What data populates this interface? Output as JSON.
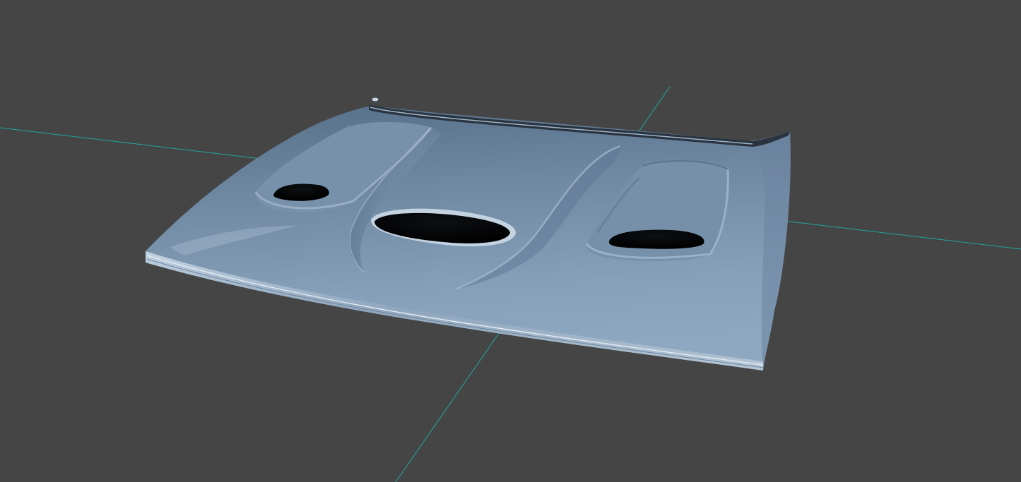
{
  "viewport": {
    "background_color": "#454545",
    "grid_axis_color": "#1fa7a0",
    "model": {
      "object": "car-hood",
      "base_color": "#7f97b0",
      "shadow_color": "#4f6680",
      "highlight_color": "#a9bed2",
      "vent_color": "#050608",
      "features": [
        "left-hood-vent-icon",
        "center-hood-scoop-icon",
        "right-hood-vent-icon"
      ]
    }
  }
}
